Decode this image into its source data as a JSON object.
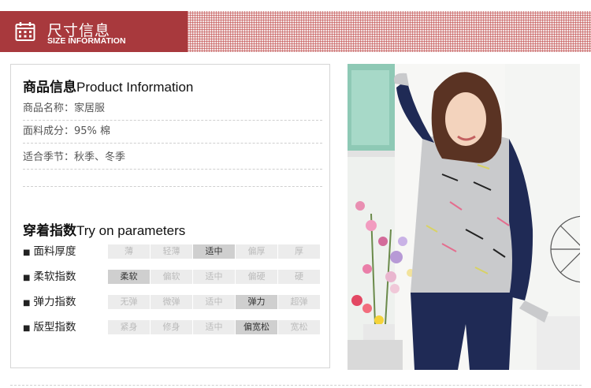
{
  "header": {
    "title_cn": "尺寸信息",
    "title_en": "SIZE INFORMATION",
    "icon": "calendar-icon"
  },
  "product": {
    "title_cn": "商品信息",
    "title_en": "Product Information",
    "rows": [
      "商品名称：家居服",
      "面料成分：95% 棉",
      "适合季节：秋季、冬季"
    ]
  },
  "params": {
    "title_cn": "穿着指数",
    "title_en": "Try on parameters",
    "bullet": "■",
    "rows": [
      {
        "label": "面料厚度",
        "options": [
          "薄",
          "轻薄",
          "适中",
          "偏厚",
          "厚"
        ],
        "selected": 2
      },
      {
        "label": "柔软指数",
        "options": [
          "柔软",
          "偏软",
          "适中",
          "偏硬",
          "硬"
        ],
        "selected": 0
      },
      {
        "label": "弹力指数",
        "options": [
          "无弹",
          "微弹",
          "适中",
          "弹力",
          "超弹"
        ],
        "selected": 3
      },
      {
        "label": "版型指数",
        "options": [
          "紧身",
          "修身",
          "适中",
          "偏宽松",
          "宽松"
        ],
        "selected": 3
      }
    ]
  },
  "colors": {
    "brand": "#a8393d",
    "selected_option": "#cfcfcf",
    "option": "#ececec"
  }
}
